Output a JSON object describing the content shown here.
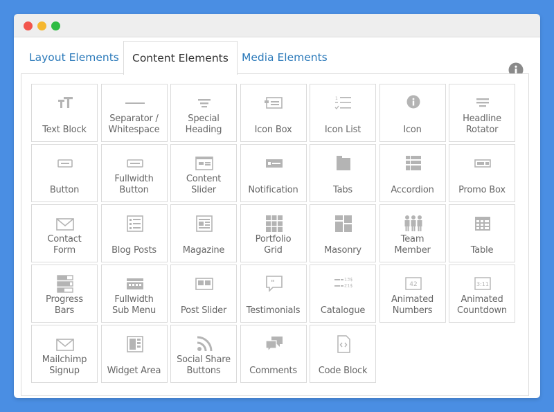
{
  "window": {
    "traffic_lights": [
      "close",
      "minimize",
      "maximize"
    ]
  },
  "tabs": [
    {
      "label": "Layout Elements",
      "active": false
    },
    {
      "label": "Content Elements",
      "active": true
    },
    {
      "label": "Media Elements",
      "active": false
    }
  ],
  "info_icon": "info-icon",
  "elements": [
    {
      "label": "Text Block",
      "icon": "text-block-icon"
    },
    {
      "label": "Separator /\nWhitespace",
      "icon": "separator-icon"
    },
    {
      "label": "Special\nHeading",
      "icon": "special-heading-icon"
    },
    {
      "label": "Icon Box",
      "icon": "icon-box-icon"
    },
    {
      "label": "Icon List",
      "icon": "icon-list-icon"
    },
    {
      "label": "Icon",
      "icon": "info-circle-icon"
    },
    {
      "label": "Headline\nRotator",
      "icon": "headline-rotator-icon"
    },
    {
      "label": "Button",
      "icon": "button-icon"
    },
    {
      "label": "Fullwidth\nButton",
      "icon": "fullwidth-button-icon"
    },
    {
      "label": "Content\nSlider",
      "icon": "content-slider-icon"
    },
    {
      "label": "Notification",
      "icon": "notification-icon"
    },
    {
      "label": "Tabs",
      "icon": "tabs-icon"
    },
    {
      "label": "Accordion",
      "icon": "accordion-icon"
    },
    {
      "label": "Promo Box",
      "icon": "promo-box-icon"
    },
    {
      "label": "Contact\nForm",
      "icon": "envelope-icon"
    },
    {
      "label": "Blog Posts",
      "icon": "blog-posts-icon"
    },
    {
      "label": "Magazine",
      "icon": "magazine-icon"
    },
    {
      "label": "Portfolio\nGrid",
      "icon": "portfolio-grid-icon"
    },
    {
      "label": "Masonry",
      "icon": "masonry-icon"
    },
    {
      "label": "Team\nMember",
      "icon": "team-member-icon"
    },
    {
      "label": "Table",
      "icon": "table-icon"
    },
    {
      "label": "Progress\nBars",
      "icon": "progress-bars-icon"
    },
    {
      "label": "Fullwidth\nSub Menu",
      "icon": "sub-menu-icon"
    },
    {
      "label": "Post Slider",
      "icon": "post-slider-icon"
    },
    {
      "label": "Testimonials",
      "icon": "testimonials-icon"
    },
    {
      "label": "Catalogue",
      "icon": "catalogue-icon",
      "icon_text": [
        "13$",
        "21$"
      ]
    },
    {
      "label": "Animated\nNumbers",
      "icon": "animated-numbers-icon",
      "icon_text": [
        "42"
      ]
    },
    {
      "label": "Animated\nCountdown",
      "icon": "animated-countdown-icon",
      "icon_text": [
        "3:11"
      ]
    },
    {
      "label": "Mailchimp\nSignup",
      "icon": "envelope-icon"
    },
    {
      "label": "Widget Area",
      "icon": "widget-area-icon"
    },
    {
      "label": "Social Share\nButtons",
      "icon": "rss-icon"
    },
    {
      "label": "Comments",
      "icon": "comments-icon"
    },
    {
      "label": "Code Block",
      "icon": "code-block-icon"
    }
  ],
  "colors": {
    "background": "#4a8ee3",
    "tab_link": "#2c7aba",
    "icon_gray": "#b4b4b4",
    "label_gray": "#666666",
    "cell_border": "#dadada"
  }
}
